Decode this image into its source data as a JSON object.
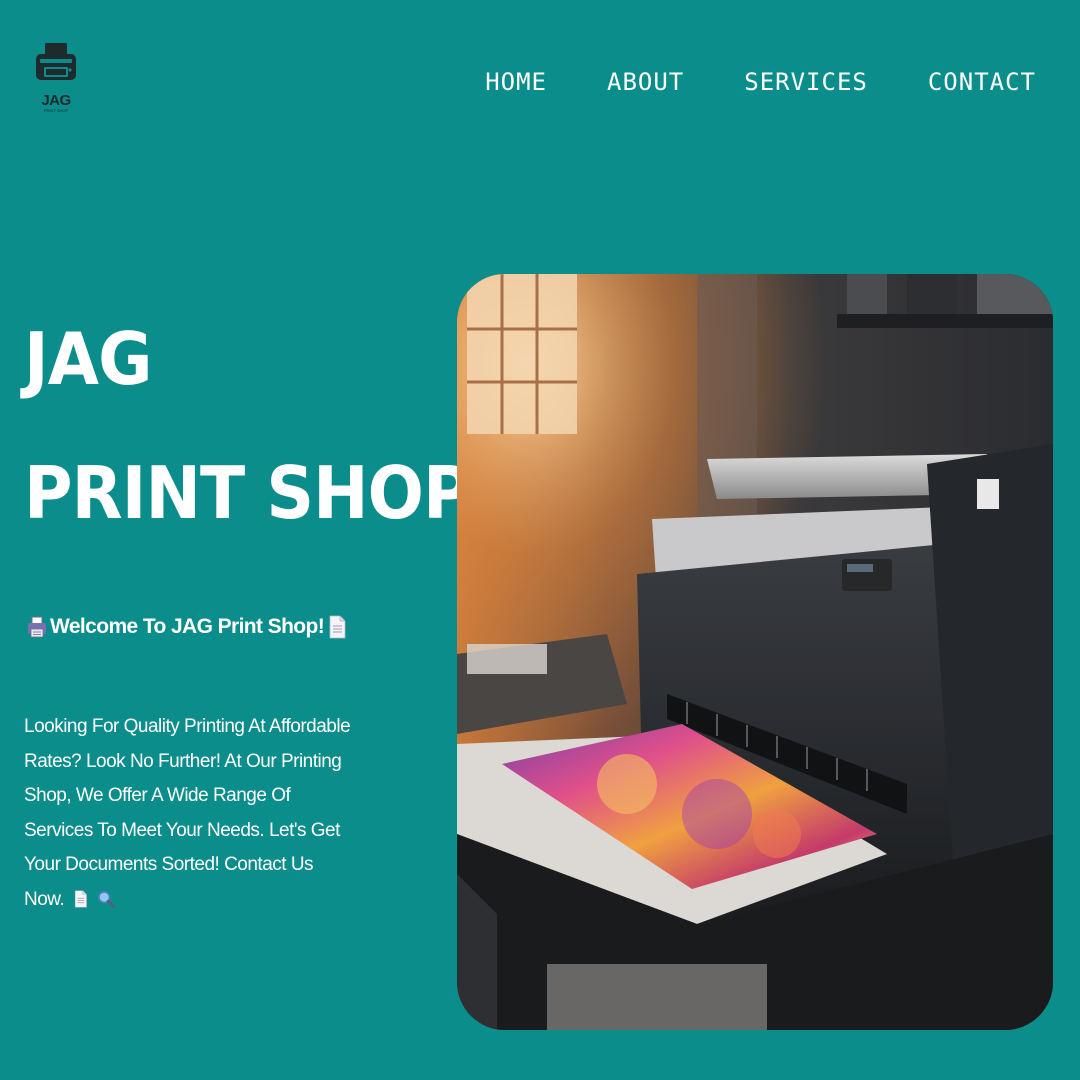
{
  "brand": {
    "logo_text": "JAG",
    "logo_subtext": "PRINT SHOP"
  },
  "nav": {
    "items": [
      {
        "label": "HOME"
      },
      {
        "label": "ABOUT"
      },
      {
        "label": "SERVICES"
      },
      {
        "label": "CONTACT"
      }
    ]
  },
  "hero": {
    "title_line1": "JAG",
    "title_line2": "PRINT SHOP",
    "welcome": "Welcome To JAG Print Shop!",
    "description": "Looking For Quality Printing At Affordable Rates? Look No Further! At Our Printing Shop, We Offer A Wide Range Of Services To Meet Your Needs. Let's Get Your Documents Sorted! Contact Us Now.",
    "welcome_icons": [
      "printer-emoji-icon",
      "document-emoji-icon"
    ],
    "description_icons": [
      "document-emoji-icon",
      "magnifier-emoji-icon"
    ]
  },
  "colors": {
    "background": "#0b8d8c",
    "text": "#ffffff",
    "logo_dark": "#1e2a2c"
  },
  "image": {
    "subject": "large-format-printer-photo"
  }
}
